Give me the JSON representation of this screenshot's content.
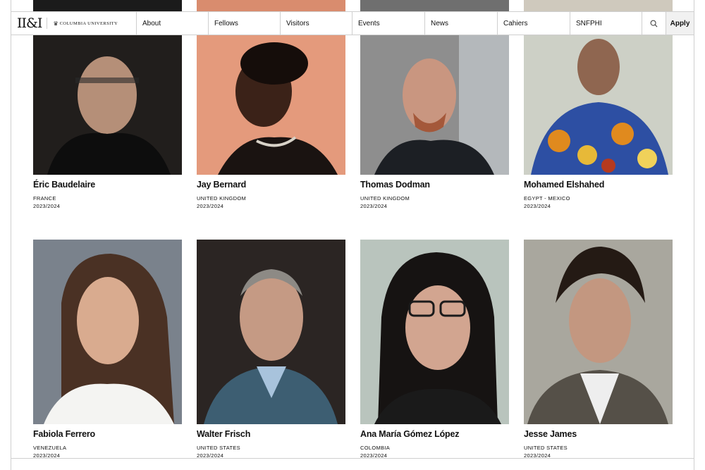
{
  "nav": {
    "logo_mark": "II&I",
    "logo_text": "Columbia University",
    "items": [
      "About",
      "Fellows",
      "Visitors",
      "Events",
      "News",
      "Cahiers",
      "SNFPHI"
    ],
    "apply_label": "Apply"
  },
  "fellows_row1": [
    {
      "name": "Éric Baudelaire",
      "country": "FRANCE",
      "year": "2023/2024"
    },
    {
      "name": "Jay Bernard",
      "country": "UNITED KINGDOM",
      "year": "2023/2024"
    },
    {
      "name": "Thomas Dodman",
      "country": "UNITED KINGDOM",
      "year": "2023/2024"
    },
    {
      "name": "Mohamed Elshahed",
      "country": "EGYPT - MEXICO",
      "year": "2023/2024"
    }
  ],
  "fellows_row2": [
    {
      "name": "Fabiola Ferrero",
      "country": "VENEZUELA",
      "year": "2023/2024"
    },
    {
      "name": "Walter Frisch",
      "country": "UNITED STATES",
      "year": "2023/2024"
    },
    {
      "name": "Ana María Gómez López",
      "country": "COLOMBIA",
      "year": "2023/2024"
    },
    {
      "name": "Jesse James",
      "country": "UNITED STATES",
      "year": "2023/2024"
    }
  ],
  "colors": {
    "border": "#cfcfcf",
    "apply_bg": "#f1f1f1"
  }
}
